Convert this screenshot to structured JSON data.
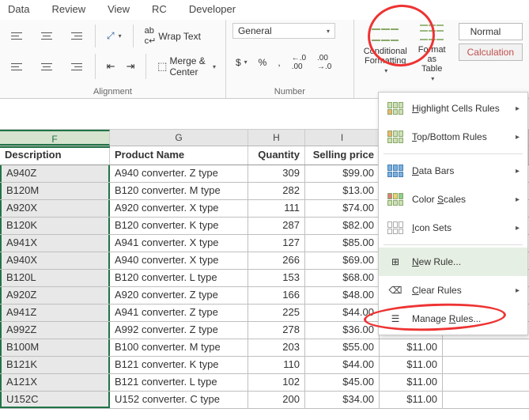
{
  "tabs": {
    "data": "Data",
    "review": "Review",
    "view": "View",
    "rc": "RC",
    "developer": "Developer"
  },
  "alignment": {
    "wrap": "Wrap Text",
    "merge": "Merge & Center",
    "label": "Alignment"
  },
  "number": {
    "format": "General",
    "label": "Number",
    "currency": "$",
    "percent": "%",
    "comma": ",",
    "inc": ".0 .00",
    "dec": ".00 .0"
  },
  "styles": {
    "cf": "Conditional Formatting",
    "ft": "Format as Table",
    "normal": "Normal",
    "calc": "Calculation"
  },
  "columns": {
    "F": "F",
    "G": "G",
    "H": "H",
    "I": "I"
  },
  "headers": {
    "desc": "Description",
    "prod": "Product Name",
    "qty": "Quantity",
    "price": "Selling price"
  },
  "menu": {
    "highlight": "Highlight Cells Rules",
    "topbottom": "Top/Bottom Rules",
    "databars": "Data Bars",
    "colorscales": "Color Scales",
    "iconsets": "Icon Sets",
    "newrule": "New Rule...",
    "clearrules": "Clear Rules",
    "managerules": "Manage Rules..."
  },
  "rows": [
    {
      "desc": "A940Z",
      "prod": "A940 converter. Z type",
      "qty": "309",
      "price": "$99.00",
      "extra": ""
    },
    {
      "desc": "B120M",
      "prod": "B120 converter. M type",
      "qty": "282",
      "price": "$13.00",
      "extra": ""
    },
    {
      "desc": "A920X",
      "prod": "A920 converter. X type",
      "qty": "111",
      "price": "$74.00",
      "extra": ""
    },
    {
      "desc": "B120K",
      "prod": "B120 converter. K type",
      "qty": "287",
      "price": "$82.00",
      "extra": ""
    },
    {
      "desc": "A941X",
      "prod": "A941 converter. X type",
      "qty": "127",
      "price": "$85.00",
      "extra": ""
    },
    {
      "desc": "A940X",
      "prod": "A940 converter. X type",
      "qty": "266",
      "price": "$69.00",
      "extra": ""
    },
    {
      "desc": "B120L",
      "prod": "B120 converter. L type",
      "qty": "153",
      "price": "$68.00",
      "extra": ""
    },
    {
      "desc": "A920Z",
      "prod": "A920 converter. Z type",
      "qty": "166",
      "price": "$48.00",
      "extra": ""
    },
    {
      "desc": "A941Z",
      "prod": "A941 converter. Z type",
      "qty": "225",
      "price": "$44.00",
      "extra": ""
    },
    {
      "desc": "A992Z",
      "prod": "A992 converter. Z type",
      "qty": "278",
      "price": "$36.00",
      "extra": ""
    },
    {
      "desc": "B100M",
      "prod": "B100 converter. M type",
      "qty": "203",
      "price": "$55.00",
      "extra": "$11.00"
    },
    {
      "desc": "B121K",
      "prod": "B121 converter. K type",
      "qty": "110",
      "price": "$44.00",
      "extra": "$11.00"
    },
    {
      "desc": "A121X",
      "prod": "B121 converter. L type",
      "qty": "102",
      "price": "$45.00",
      "extra": "$11.00"
    },
    {
      "desc": "U152C",
      "prod": "U152 converter. C type",
      "qty": "200",
      "price": "$34.00",
      "extra": "$11.00"
    }
  ]
}
